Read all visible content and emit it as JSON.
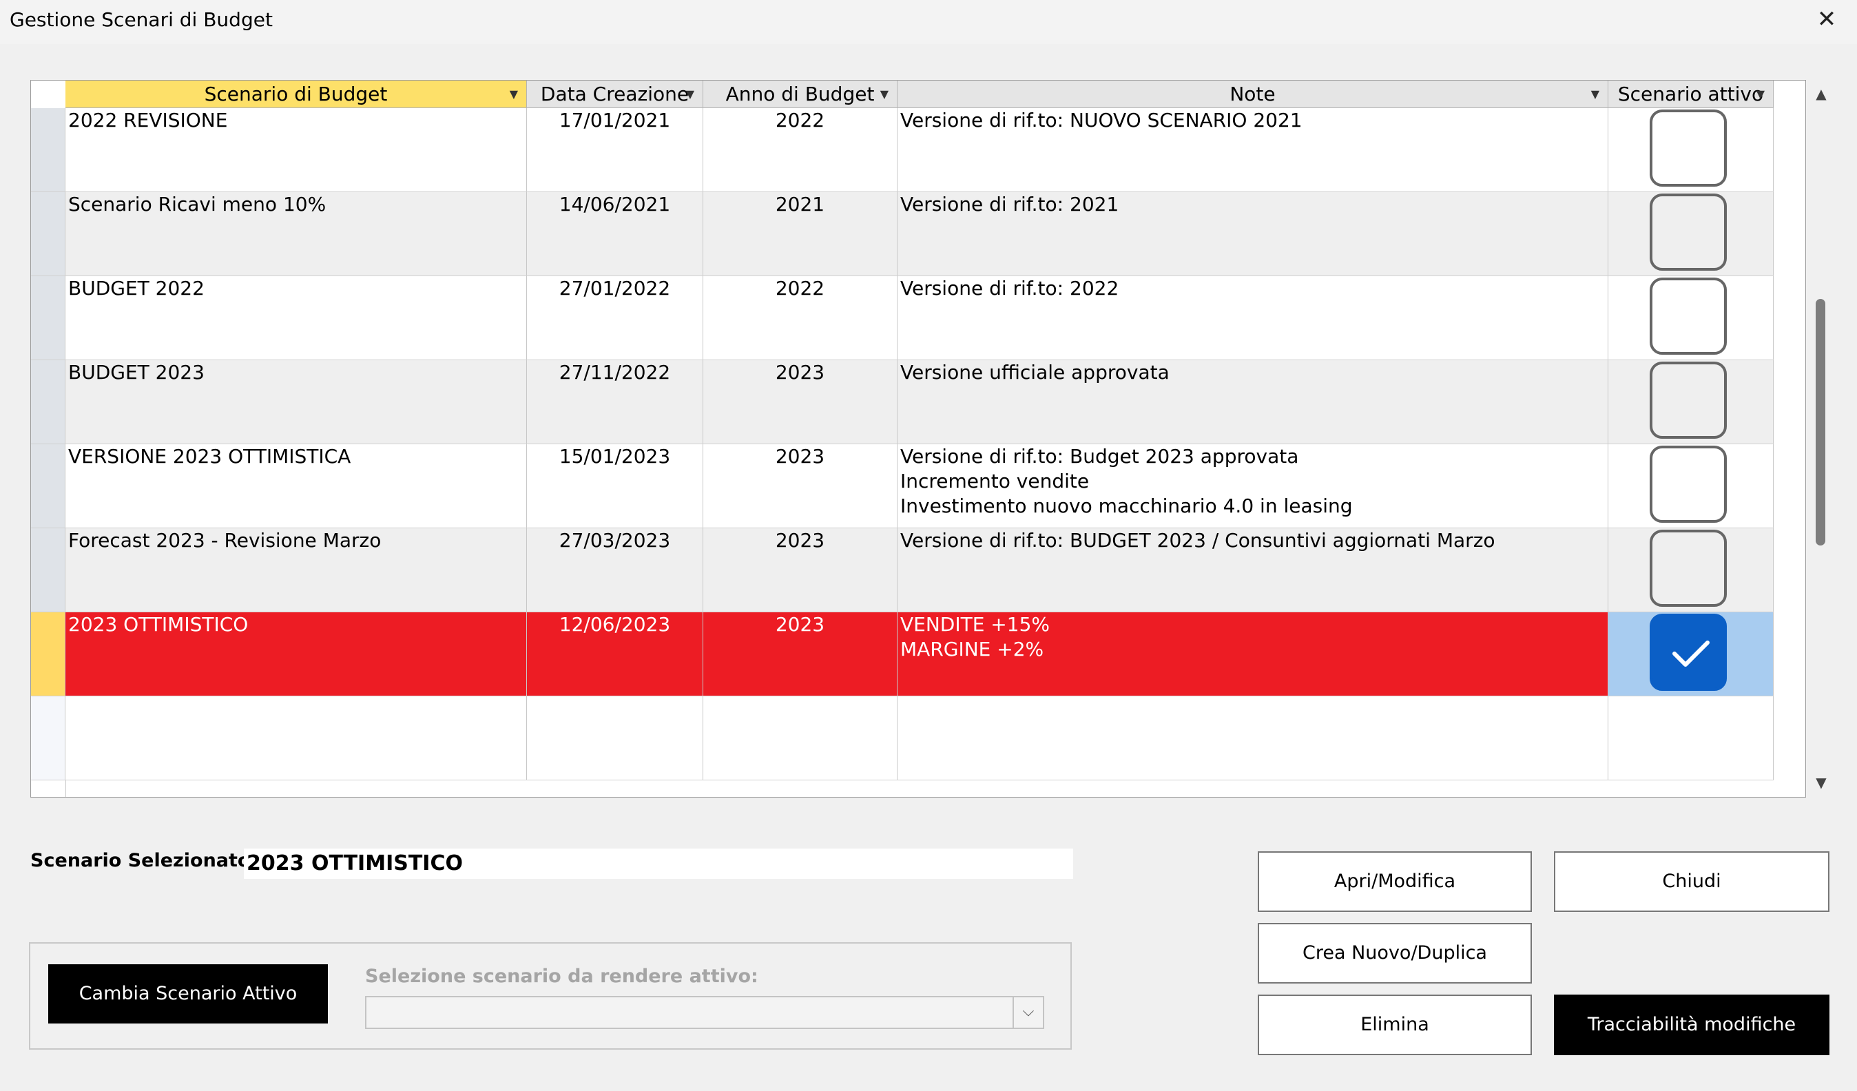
{
  "window": {
    "title": "Gestione Scenari di Budget",
    "close_glyph": "✕"
  },
  "grid": {
    "columns": [
      {
        "label": "Scenario di Budget",
        "active": true
      },
      {
        "label": "Data Creazione"
      },
      {
        "label": "Anno di Budget"
      },
      {
        "label": "Note"
      },
      {
        "label": "Scenario attivo"
      }
    ],
    "rows": [
      {
        "scenario": "2022 REVISIONE",
        "date": "17/01/2021",
        "year": "2022",
        "note": "Versione di rif.to: NUOVO SCENARIO 2021",
        "active": false
      },
      {
        "scenario": "Scenario Ricavi meno 10%",
        "date": "14/06/2021",
        "year": "2021",
        "note": "Versione di rif.to: 2021",
        "active": false
      },
      {
        "scenario": "BUDGET 2022",
        "date": "27/01/2022",
        "year": "2022",
        "note": "Versione di rif.to: 2022",
        "active": false
      },
      {
        "scenario": "BUDGET 2023",
        "date": "27/11/2022",
        "year": "2023",
        "note": "Versione ufficiale approvata",
        "active": false
      },
      {
        "scenario": "VERSIONE 2023 OTTIMISTICA",
        "date": "15/01/2023",
        "year": "2023",
        "note": "Versione di rif.to: Budget 2023 approvata\nIncremento vendite\nInvestimento nuovo macchinario 4.0 in leasing",
        "active": false
      },
      {
        "scenario": "Forecast 2023 - Revisione Marzo",
        "date": "27/03/2023",
        "year": "2023",
        "note": "Versione di rif.to: BUDGET 2023 / Consuntivi aggiornati Marzo",
        "active": false
      },
      {
        "scenario": "2023 OTTIMISTICO",
        "date": "12/06/2023",
        "year": "2023",
        "note": "VENDITE +15%\nMARGINE +2%",
        "active": true
      }
    ]
  },
  "selected": {
    "label": "Scenario Selezionato:",
    "value": "2023 OTTIMISTICO"
  },
  "change_active": {
    "button_label": "Cambia Scenario Attivo",
    "combo_label": "Selezione scenario da rendere attivo:",
    "combo_value": ""
  },
  "actions": {
    "open_edit": "Apri/Modifica",
    "close": "Chiudi",
    "create_duplicate": "Crea Nuovo/Duplica",
    "delete": "Elimina",
    "traceability": "Tracciabilità modifiche"
  },
  "icons": {
    "sort_arrow": "sort-dropdown-icon",
    "checkmark": "checkmark-icon",
    "combo_arrow": "chevron-down-icon"
  },
  "colors": {
    "selected_row": "#ed1c24",
    "active_header": "#fde069",
    "checkbox_on": "#0b5fc6",
    "check_cell_selected": "#a8ccf0"
  }
}
